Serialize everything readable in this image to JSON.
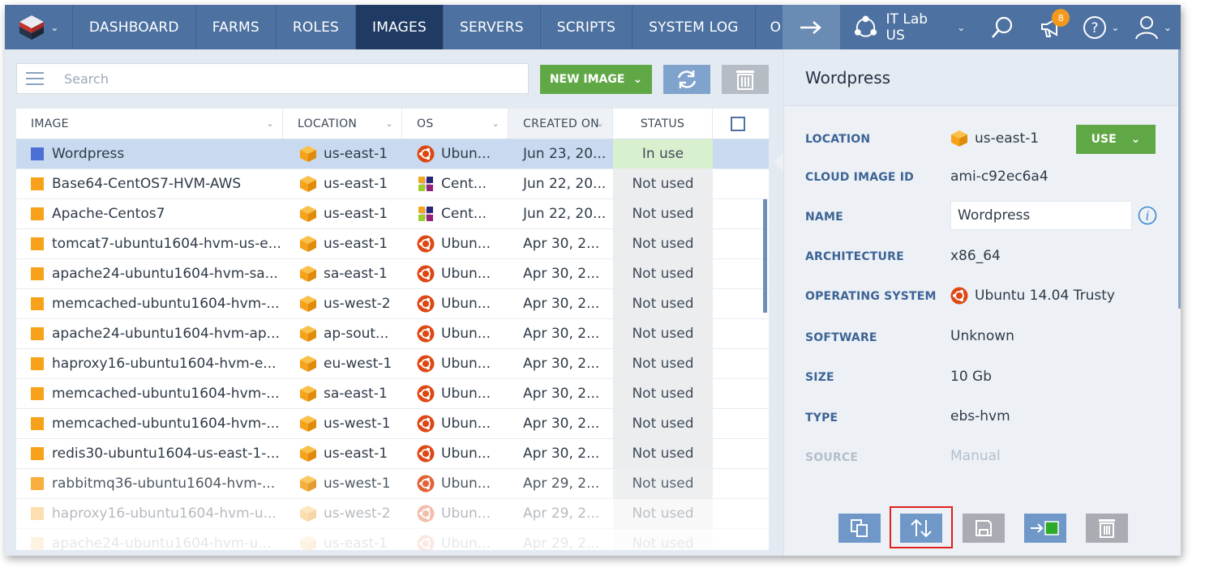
{
  "nav": {
    "items": [
      "DASHBOARD",
      "FARMS",
      "ROLES",
      "IMAGES",
      "SERVERS",
      "SCRIPTS",
      "SYSTEM LOG",
      "O"
    ],
    "active": "IMAGES",
    "environment": "IT Lab US",
    "notifications_count": "8",
    "icons": [
      "logo-icon",
      "arrow-right-icon",
      "environment-icon",
      "search-icon",
      "megaphone-icon",
      "help-icon",
      "user-icon"
    ]
  },
  "toolbar": {
    "search_placeholder": "Search",
    "new_image_label": "NEW IMAGE",
    "refresh_icon": "refresh-icon",
    "delete_icon": "trash-icon"
  },
  "grid": {
    "columns": [
      "IMAGE",
      "LOCATION",
      "OS",
      "CREATED ON",
      "STATUS"
    ],
    "rows": [
      {
        "image": "Wordpress",
        "location": "us-east-1",
        "os": "Ubun...",
        "os_icon": "ubuntu",
        "created": "Jun 23, 20...",
        "status": "In use"
      },
      {
        "image": "Base64-CentOS7-HVM-AWS",
        "location": "us-east-1",
        "os": "Cent...",
        "os_icon": "centos",
        "created": "Jun 22, 20...",
        "status": "Not used"
      },
      {
        "image": "Apache-Centos7",
        "location": "us-east-1",
        "os": "Cent...",
        "os_icon": "centos",
        "created": "Jun 22, 20...",
        "status": "Not used"
      },
      {
        "image": "tomcat7-ubuntu1604-hvm-us-e...",
        "location": "us-east-1",
        "os": "Ubun...",
        "os_icon": "ubuntu",
        "created": "Apr 30, 2...",
        "status": "Not used"
      },
      {
        "image": "apache24-ubuntu1604-hvm-sa...",
        "location": "sa-east-1",
        "os": "Ubun...",
        "os_icon": "ubuntu",
        "created": "Apr 30, 2...",
        "status": "Not used"
      },
      {
        "image": "memcached-ubuntu1604-hvm-...",
        "location": "us-west-2",
        "os": "Ubun...",
        "os_icon": "ubuntu",
        "created": "Apr 30, 2...",
        "status": "Not used"
      },
      {
        "image": "apache24-ubuntu1604-hvm-ap...",
        "location": "ap-sout...",
        "os": "Ubun...",
        "os_icon": "ubuntu",
        "created": "Apr 30, 2...",
        "status": "Not used"
      },
      {
        "image": "haproxy16-ubuntu1604-hvm-e...",
        "location": "eu-west-1",
        "os": "Ubun...",
        "os_icon": "ubuntu",
        "created": "Apr 30, 2...",
        "status": "Not used"
      },
      {
        "image": "memcached-ubuntu1604-hvm-...",
        "location": "sa-east-1",
        "os": "Ubun...",
        "os_icon": "ubuntu",
        "created": "Apr 30, 2...",
        "status": "Not used"
      },
      {
        "image": "memcached-ubuntu1604-hvm-...",
        "location": "us-west-1",
        "os": "Ubun...",
        "os_icon": "ubuntu",
        "created": "Apr 30, 2...",
        "status": "Not used"
      },
      {
        "image": "redis30-ubuntu1604-us-east-1-...",
        "location": "us-east-1",
        "os": "Ubun...",
        "os_icon": "ubuntu",
        "created": "Apr 30, 2...",
        "status": "Not used"
      },
      {
        "image": "rabbitmq36-ubuntu1604-hvm-...",
        "location": "us-west-1",
        "os": "Ubun...",
        "os_icon": "ubuntu",
        "created": "Apr 29, 2...",
        "status": "Not used"
      },
      {
        "image": "haproxy16-ubuntu1604-hvm-u...",
        "location": "us-west-2",
        "os": "Ubun...",
        "os_icon": "ubuntu",
        "created": "Apr 29, 2...",
        "status": "Not used"
      },
      {
        "image": "apache24-ubuntu1604-hvm-u...",
        "location": "us-east-1",
        "os": "Ubun...",
        "os_icon": "ubuntu",
        "created": "Apr 29, 2...",
        "status": "Not used"
      }
    ]
  },
  "panel": {
    "title": "Wordpress",
    "location_label": "LOCATION",
    "location_value": "us-east-1",
    "use_label": "USE",
    "cloud_image_id_label": "CLOUD IMAGE ID",
    "cloud_image_id_value": "ami-c92ec6a4",
    "name_label": "NAME",
    "name_value": "Wordpress",
    "architecture_label": "ARCHITECTURE",
    "architecture_value": "x86_64",
    "os_label": "OPERATING SYSTEM",
    "os_value": "Ubuntu 14.04 Trusty",
    "software_label": "SOFTWARE",
    "software_value": "Unknown",
    "size_label": "SIZE",
    "size_value": "10 Gb",
    "type_label": "TYPE",
    "type_value": "ebs-hvm",
    "source_label": "SOURCE",
    "source_value": "Manual",
    "actions": [
      "copy-icon",
      "sort-arrows-icon",
      "save-icon",
      "move-to-icon",
      "trash-icon"
    ]
  },
  "colors": {
    "nav_bg": "#4d71a0",
    "nav_active": "#1f3b63",
    "accent_green": "#60a845",
    "highlight_red": "#e0201c",
    "image_orange": "#f8a21c"
  }
}
